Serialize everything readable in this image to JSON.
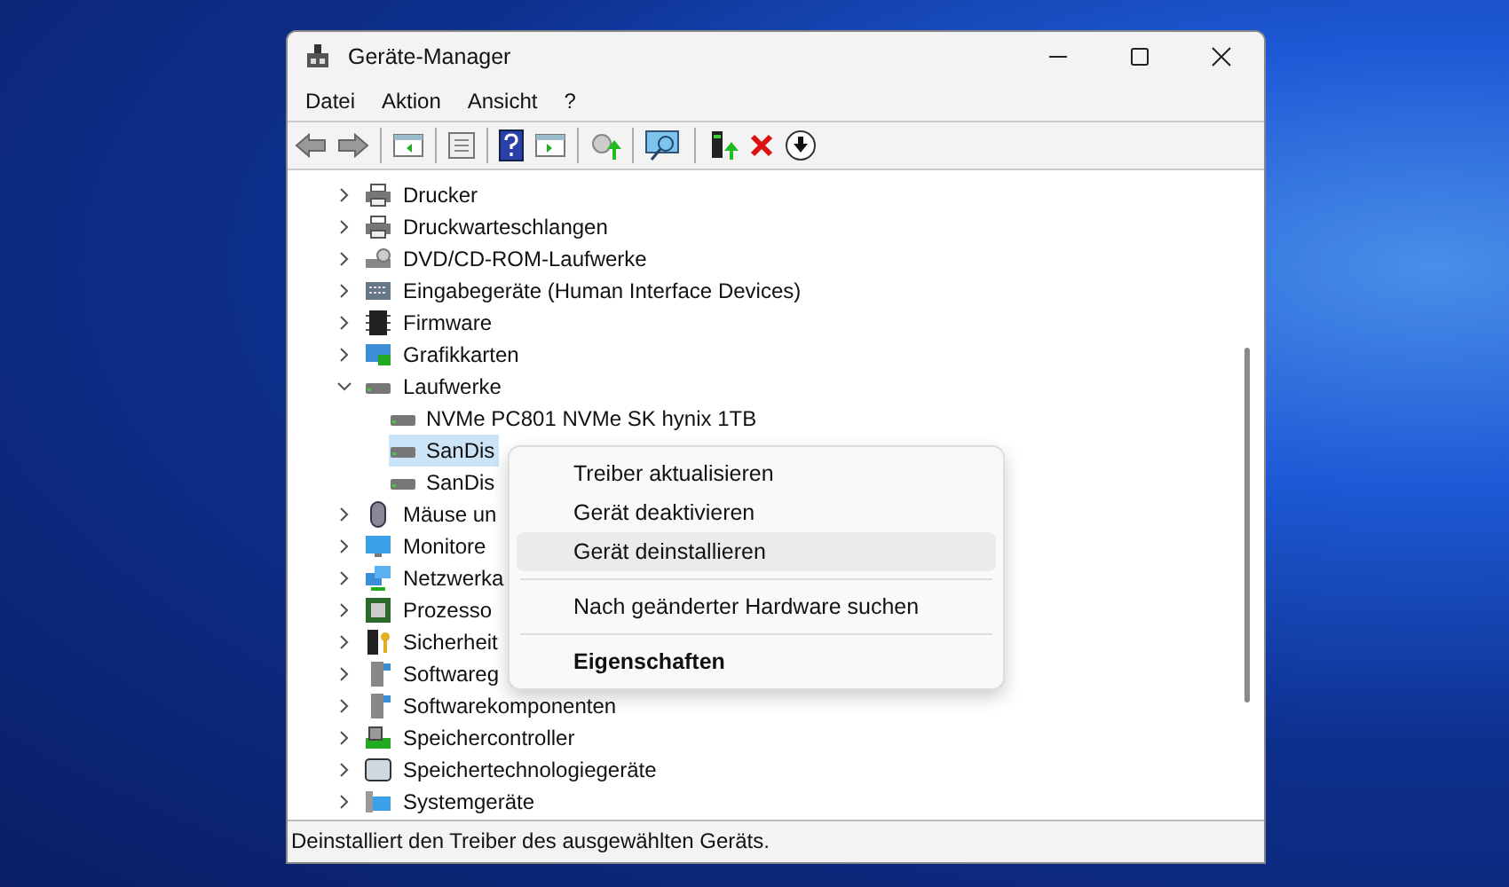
{
  "window": {
    "title": "Geräte-Manager"
  },
  "menu_bar": [
    "Datei",
    "Aktion",
    "Ansicht",
    "?"
  ],
  "tree": [
    {
      "label": "Drucker",
      "expanded": false,
      "selected": false
    },
    {
      "label": "Druckwarteschlangen",
      "expanded": false,
      "selected": false
    },
    {
      "label": "DVD/CD-ROM-Laufwerke",
      "expanded": false,
      "selected": false
    },
    {
      "label": "Eingabegeräte (Human Interface Devices)",
      "expanded": false,
      "selected": false
    },
    {
      "label": "Firmware",
      "expanded": false,
      "selected": false
    },
    {
      "label": "Grafikkarten",
      "expanded": false,
      "selected": false
    },
    {
      "label": "Laufwerke",
      "expanded": true,
      "selected": false,
      "children": [
        {
          "label": "NVMe PC801 NVMe SK hynix 1TB",
          "selected": false
        },
        {
          "label": "SanDis",
          "selected": true
        },
        {
          "label": "SanDis",
          "selected": false
        }
      ]
    },
    {
      "label": "Mäuse un",
      "expanded": false,
      "selected": false
    },
    {
      "label": "Monitore",
      "expanded": false,
      "selected": false
    },
    {
      "label": "Netzwerka",
      "expanded": false,
      "selected": false
    },
    {
      "label": "Prozesso",
      "expanded": false,
      "selected": false
    },
    {
      "label": "Sicherheit",
      "expanded": false,
      "selected": false
    },
    {
      "label": "Softwareg",
      "expanded": false,
      "selected": false
    },
    {
      "label": "Softwarekomponenten",
      "expanded": false,
      "selected": false
    },
    {
      "label": "Speichercontroller",
      "expanded": false,
      "selected": false
    },
    {
      "label": "Speichertechnologiegeräte",
      "expanded": false,
      "selected": false
    },
    {
      "label": "Systemgeräte",
      "expanded": false,
      "selected": false
    }
  ],
  "context_menu": [
    {
      "kind": "item",
      "label": "Treiber aktualisieren",
      "highlighted": false
    },
    {
      "kind": "item",
      "label": "Gerät deaktivieren",
      "highlighted": false
    },
    {
      "kind": "item",
      "label": "Gerät deinstallieren",
      "highlighted": true
    },
    {
      "kind": "separator"
    },
    {
      "kind": "item",
      "label": "Nach geänderter Hardware suchen",
      "highlighted": false
    },
    {
      "kind": "separator"
    },
    {
      "kind": "default",
      "label": "Eigenschaften",
      "highlighted": false
    }
  ],
  "status_bar": "Deinstalliert den Treiber des ausgewählten Geräts."
}
